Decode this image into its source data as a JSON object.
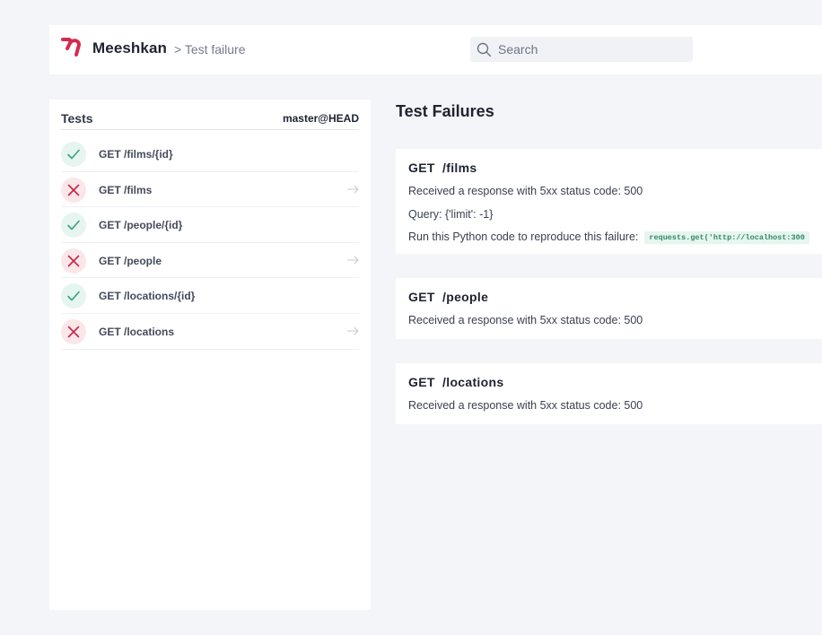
{
  "header": {
    "brand": "Meeshkan",
    "breadcrumb": "> Test failure",
    "search": {
      "placeholder": "Search",
      "value": ""
    }
  },
  "tests_panel": {
    "title": "Tests",
    "branch": "master@HEAD",
    "items": [
      {
        "label": "GET /films/{id}",
        "status": "pass"
      },
      {
        "label": "GET /films",
        "status": "fail"
      },
      {
        "label": "GET /people/{id}",
        "status": "pass"
      },
      {
        "label": "GET /people",
        "status": "fail"
      },
      {
        "label": "GET /locations/{id}",
        "status": "pass"
      },
      {
        "label": "GET /locations",
        "status": "fail"
      }
    ]
  },
  "main": {
    "title": "Test Failures",
    "failures": [
      {
        "title": "GET  /films",
        "message": "Received a response with 5xx status code: 500",
        "query": "Query: {'limit': -1}",
        "reproduce": "Run this Python code to reproduce this failure:",
        "code": "requests.get('http://localhost:300"
      },
      {
        "title": "GET  /people",
        "message": "Received a response with 5xx status code: 500"
      },
      {
        "title": "GET  /locations",
        "message": "Received a response with 5xx status code: 500"
      }
    ]
  },
  "colors": {
    "brand": "#d6294f",
    "pass": "#3aa17e",
    "fail": "#c4274a",
    "code_bg": "#e6f5ef",
    "code_text": "#2f8a64"
  },
  "icons": {
    "logo": "meeshkan-logo-icon",
    "search": "search-icon",
    "pass": "check-icon",
    "fail": "cross-icon",
    "arrow": "arrow-right-icon"
  }
}
